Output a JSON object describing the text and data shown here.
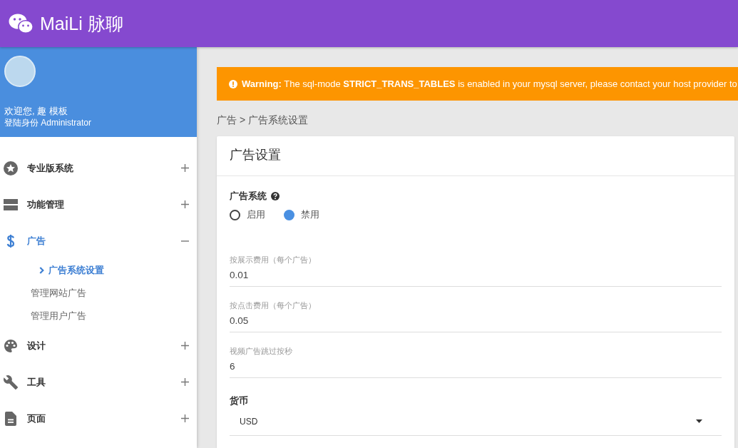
{
  "header": {
    "title": "MaiLi 脉聊"
  },
  "profile": {
    "greeting": "欢迎您, 趣 模板",
    "role": "登陆身份 Administrator"
  },
  "sidebar": {
    "items": [
      {
        "label": "专业版系统",
        "selected": false,
        "expanded": false
      },
      {
        "label": "功能管理",
        "selected": false,
        "expanded": false
      },
      {
        "label": "广告",
        "selected": true,
        "expanded": true,
        "children": [
          {
            "label": "广告系统设置",
            "selected": true
          },
          {
            "label": "管理网站广告",
            "selected": false
          },
          {
            "label": "管理用户广告",
            "selected": false
          }
        ]
      },
      {
        "label": "设计",
        "selected": false,
        "expanded": false
      },
      {
        "label": "工具",
        "selected": false,
        "expanded": false
      },
      {
        "label": "页面",
        "selected": false,
        "expanded": false
      }
    ]
  },
  "warning": {
    "text": "**Warning:** The sql-mode **STRICT_TRANS_TABLES** is enabled in your mysql server, please contact your host provider to"
  },
  "breadcrumb": "广告 > 广告系统设置",
  "card": {
    "title": "广告设置",
    "ad_system": {
      "label": "广告系统",
      "options": [
        {
          "label": "启用",
          "selected": false
        },
        {
          "label": "禁用",
          "selected": true
        }
      ]
    },
    "fields": [
      {
        "label": "按展示费用（每个广告）",
        "value": "0.01"
      },
      {
        "label": "按点击费用（每个广告）",
        "value": "0.05"
      },
      {
        "label": "视频广告跳过按秒",
        "value": "6"
      }
    ],
    "currency": {
      "label": "货币",
      "value": "USD"
    }
  }
}
